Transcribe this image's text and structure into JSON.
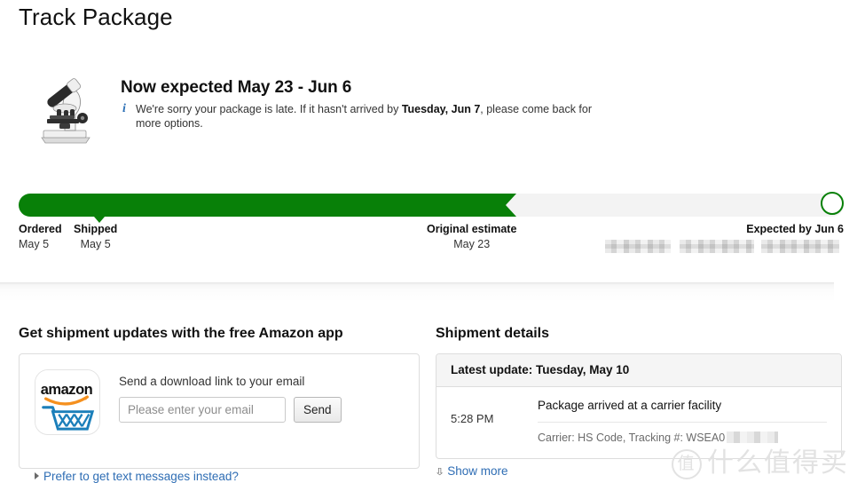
{
  "page": {
    "title": "Track Package"
  },
  "hero": {
    "product_image": "microscope-photo",
    "headline": "Now expected May 23 - Jun 6",
    "info_icon": "info-icon",
    "note_part_1": "We're sorry your package is late. If it hasn't arrived by ",
    "note_bold": "Tuesday, Jun 7",
    "note_part_2": ", please come back for more options."
  },
  "progress": {
    "fill_percent": 59,
    "current_marker_percent": 9.8,
    "fill_color": "#088008",
    "track_color": "#f3f3f3",
    "endcap_icon": "circle-outline-icon",
    "milestones": [
      {
        "label": "Ordered",
        "date": "May 5"
      },
      {
        "label": "Shipped",
        "date": "May 5"
      },
      {
        "label": "Original estimate",
        "date": "May 23"
      },
      {
        "label": "Expected by Jun 6",
        "date": ""
      }
    ]
  },
  "app_promo": {
    "section_title": "Get shipment updates with the free Amazon app",
    "app_icon": "amazon-shopping-app-icon",
    "app_icon_wordmark": "amazon",
    "prompt": "Send a download link to your email",
    "email_placeholder": "Please enter your email",
    "email_value": "",
    "send_label": "Send",
    "sms_link": "Prefer to get text messages instead?",
    "sms_link_color": "#2e6db4"
  },
  "shipment_details": {
    "section_title": "Shipment details",
    "latest_update": "Latest update: Tuesday, May 10",
    "events": [
      {
        "time": "5:28 PM",
        "title": "Package arrived at a carrier facility",
        "subtitle": "Carrier: HS Code, Tracking #: WSEA0"
      }
    ],
    "show_more_label": "Show more",
    "show_more_icon": "chevron-double-down-icon"
  },
  "watermark": {
    "badge": "值",
    "text": "什么值得买"
  }
}
